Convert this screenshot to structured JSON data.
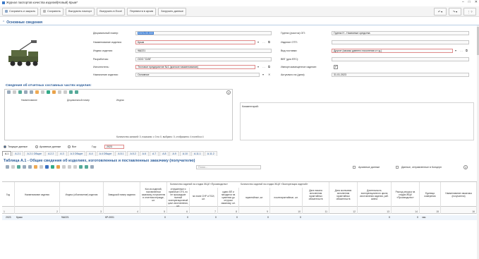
{
  "window": {
    "title": "Журнал паспортов качества изделий(Новый) Крым*",
    "ctl": [
      "–",
      "□",
      "✕"
    ]
  },
  "toolbar": {
    "buttons": [
      "Сохранить и закрыть",
      "Сохранить",
      "Выгрузить паспорт",
      "Выгрузить в Excel",
      "Перевести в архив",
      "Загрузить данные"
    ],
    "right": [
      "↶ ▾",
      "↷ ▾",
      "⋮ ?"
    ]
  },
  "section": {
    "title": "Основные сведения"
  },
  "fields": {
    "decimal_label": "Децимальный номер:",
    "decimal_value": "ЕАТА.00.000",
    "name_label": "Наименование изделия:",
    "name_value": "Крым",
    "index_label": "Индекс изделия:",
    "index_value": "9Ш221",
    "dev_label": "Разработчик:",
    "dev_value": "ООО \"СИК\"",
    "maker_label": "Исполнитель:",
    "maker_value": "Тестовое предприятие №1 (краткое наименование)",
    "purpose_label": "Назначение изделия:",
    "purpose_value": "Основное",
    "group_label": "Группа (участок) ОП:",
    "group_value": "Группа Н - Наземные средства",
    "otp_label": "Изделие ОТП:",
    "otp_value": "",
    "delivery_label": "Вид поставки:",
    "delivery_value": "Другое (заказы давнего поколения и т.д.)",
    "vvt_label": "ВВТ (для ВТС):",
    "vvt_value": "",
    "import_label": "Импортозамещенное изделие:",
    "actual_label": "Актуально на (дата):",
    "actual_value": "31.01.2023"
  },
  "parts": {
    "title": "Сведения об отчетных составных частях изделия:",
    "cols": [
      "Наименование",
      "Децимальный номер",
      "Индекс"
    ],
    "count": "Количество записей: 0, показано: с 0 по 0, выбрано: 0, отображено: 4 полей из 4"
  },
  "comment": {
    "label": "Комментарий:"
  },
  "filter": {
    "options": [
      "Текущие данные",
      "Архивные данные",
      "Все"
    ],
    "year_label": "Год:",
    "year_value": "2023"
  },
  "tabs": [
    "А.1",
    "А.2.1",
    "А.2.1 Общие",
    "А.2.2",
    "А.3",
    "А.3 Общие",
    "А.4",
    "А.4 Общие",
    "А.5.1",
    "А.5.2",
    "А.6",
    "А.7",
    "А.8",
    "А.9",
    "А.10",
    "А.11.1",
    "А.11.2"
  ],
  "table": {
    "title": "Таблица А.1 - Общие сведения об изделиях, изготовленных и поставленных заказчику (получателю)",
    "search_placeholder": "Поиск...",
    "archive_label": "Архивные данные",
    "sent_label": "Данные, отправленные в Концерн",
    "group1": "Количество изделий на стадии ЖЦИ «Производство»",
    "group2": "Количество изделий на стадии ЖЦИ «Эксплуатация изделий»",
    "headers": [
      "Год",
      "Наименование изделия",
      "Индекс (обозначение) изделия",
      "Заводской номер изделия",
      "Кол-во изделий, поставленных заказчику, получателю в отчетном периоде, шт.",
      "",
      "на этапе СНР и ПСИ, шт.",
      "сдано ВП и находится на хранении до отгрузки заказчику, шт.",
      "гарантийные, шт.",
      "послегарантийные, шт.",
      "Дата начала исполнения гарантийных обязательств",
      "Дата окончания исполнения гарантийных обязательств",
      "Длительность эксплуатационного цикла изготовления изделия, раб. смена",
      "Расход ресурса на стадии ЖЦИ «Производство»",
      "Единица измерения",
      "Наименование заказчика (получателя)"
    ],
    "header6": "отгруженные и принятые ОТК, но не прошедшие полный эксплуатационный цикл изготовления, шт.",
    "nums": [
      "1",
      "2",
      "3",
      "4",
      "5",
      "6",
      "7",
      "8",
      "9",
      "10",
      "11",
      "12",
      "13",
      "14",
      "15",
      "16"
    ],
    "row": {
      "year": "2023",
      "name": "Крым",
      "index": "9Ш221",
      "serial": "КР-0001",
      "v5": "0",
      "v6": "0",
      "v7": "0",
      "v8": "0",
      "v9": "0",
      "v10": "0",
      "v13": "0",
      "v14": "0",
      "unit": "час."
    }
  },
  "colors": {
    "accent": "#2a5c9a",
    "required": "#e08a8a",
    "selection": "#3d7fd6"
  }
}
